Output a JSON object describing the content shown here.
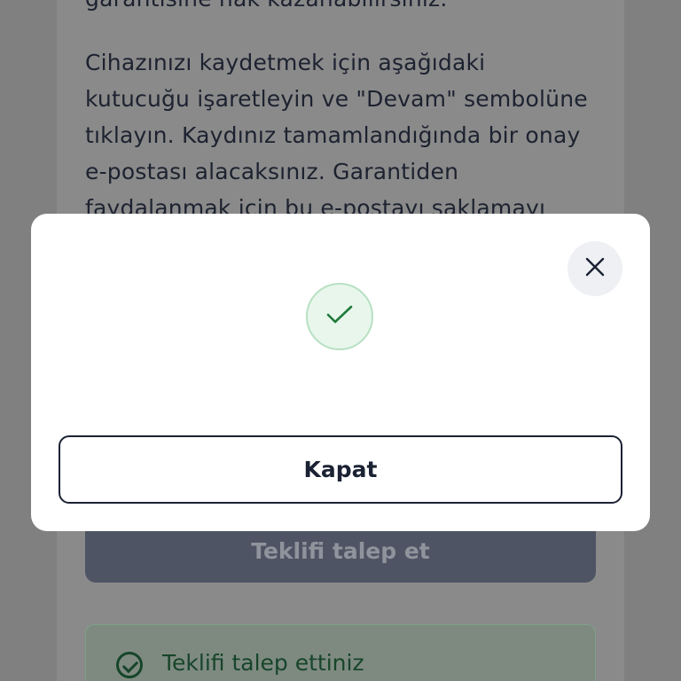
{
  "background": {
    "partial_line": "garantisine hak kazanabilirsiniz.",
    "paragraph": [
      "Cihazınızı kaydetmek için aşağıdaki",
      "kutucuğu işaretleyin ve \"Devam\" sembolüne",
      "tıklayın. Kaydınız tamamlandığında bir onay",
      "e-postası alacaksınız. Garantiden",
      "faydalanmak için bu e-postayı saklamayı"
    ],
    "request_button_label": "Teklifi talep et",
    "status_text": "Teklifi talep ettiniz"
  },
  "modal": {
    "close_icon": "close-icon",
    "success_icon": "check-icon",
    "accent_color": "#1f7a3a",
    "close_button_label": "Kapat"
  }
}
